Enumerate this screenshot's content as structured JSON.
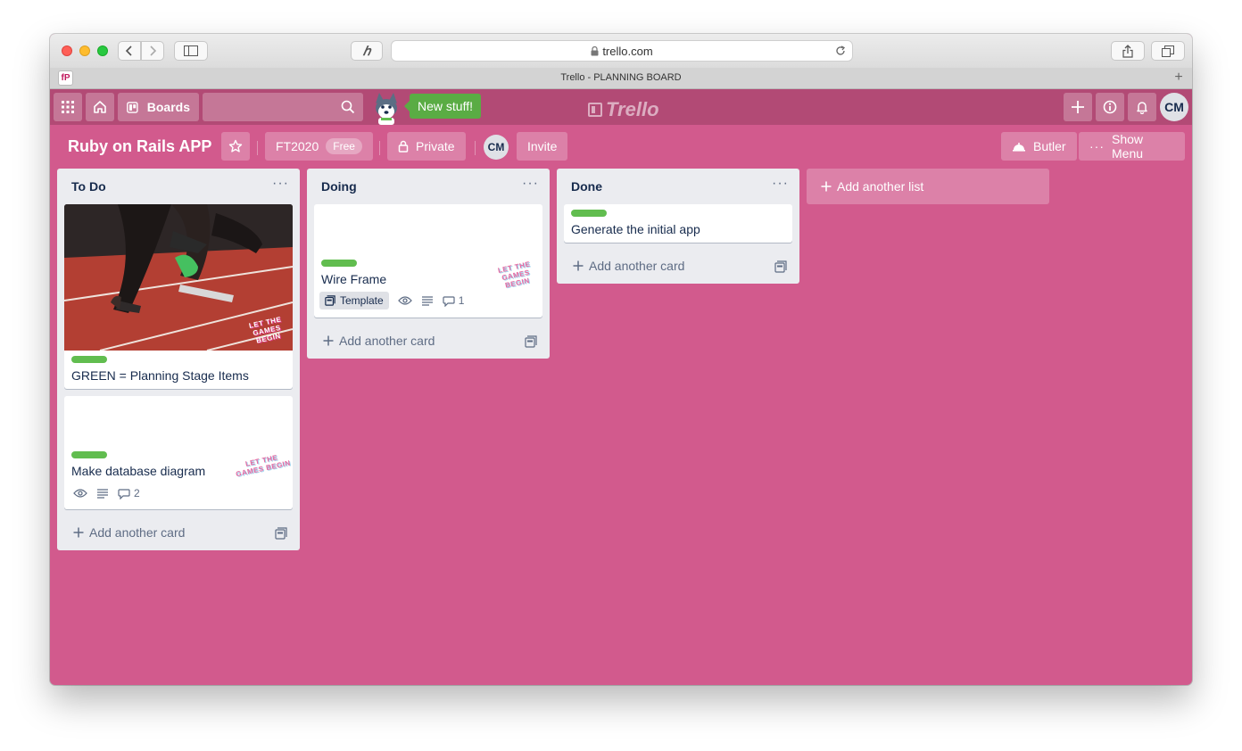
{
  "browser": {
    "address": "trello.com",
    "tab_title": "Trello - PLANNING BOARD",
    "favicon_text": "fP"
  },
  "header": {
    "boards_label": "Boards",
    "new_stuff_label": "New stuff!",
    "logo_text": "Trello",
    "avatar_initials": "CM"
  },
  "board": {
    "title": "Ruby on Rails APP",
    "team_name": "FT2020",
    "team_plan": "Free",
    "visibility": "Private",
    "member_initials": "CM",
    "invite_label": "Invite",
    "butler_label": "Butler",
    "show_menu_label": "Show Menu"
  },
  "lists": [
    {
      "name": "To Do",
      "cards": [
        {
          "title": "GREEN = Planning Stage Items",
          "label_color": "#61bd4f",
          "cover": "photo-sprinter",
          "sticker": "LET THE GAMES BEGIN"
        },
        {
          "title": "Make database diagram",
          "label_color": "#61bd4f",
          "comments": "2",
          "sticker": "LET THE GAMES BEGIN"
        }
      ],
      "add_card_label": "Add another card"
    },
    {
      "name": "Doing",
      "cards": [
        {
          "title": "Wire Frame",
          "label_color": "#61bd4f",
          "template_label": "Template",
          "comments": "1",
          "sticker": "LET THE GAMES BEGIN"
        }
      ],
      "add_card_label": "Add another card"
    },
    {
      "name": "Done",
      "cards": [
        {
          "title": "Generate the initial app",
          "label_color": "#61bd4f"
        }
      ],
      "add_card_label": "Add another card"
    }
  ],
  "add_list_label": "Add another list",
  "colors": {
    "board_bg": "#d25a8d",
    "header_bg": "#b24a75",
    "label_green": "#61bd4f",
    "new_stuff_green": "#5aac44"
  }
}
